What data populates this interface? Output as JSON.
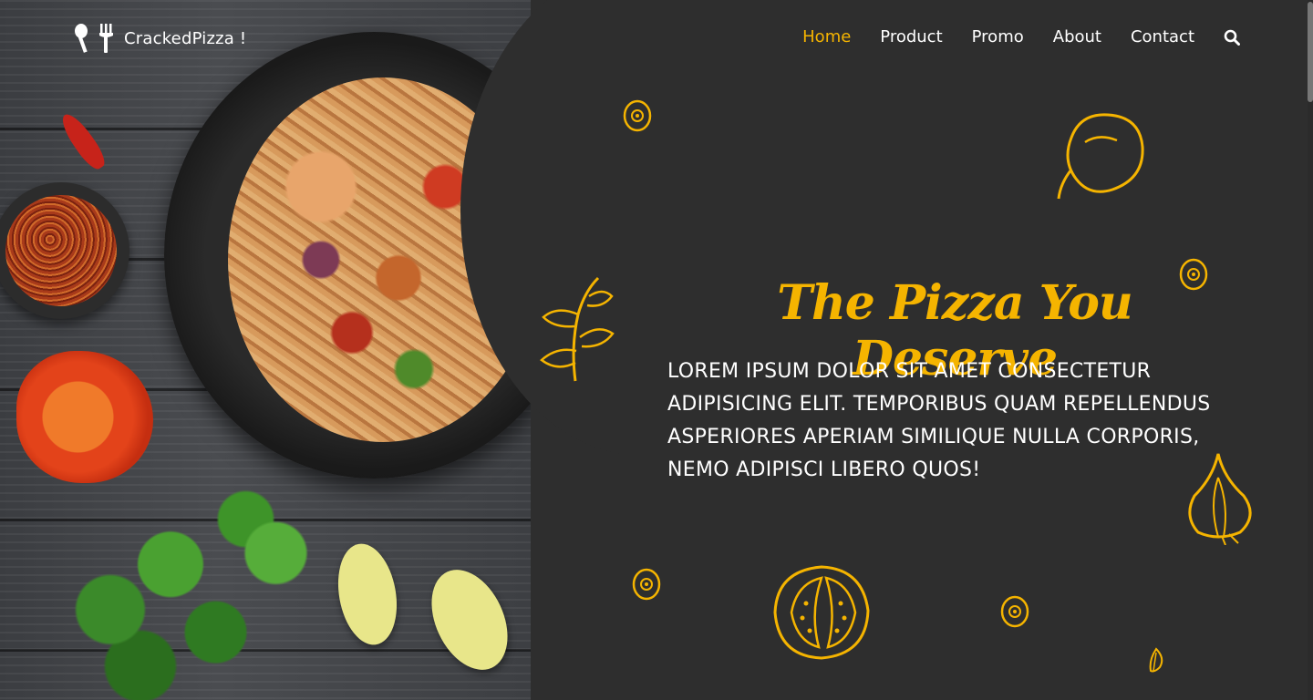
{
  "brand": {
    "name": "CrackedPizza !"
  },
  "nav": {
    "items": [
      {
        "label": "Home",
        "active": true
      },
      {
        "label": "Product",
        "active": false
      },
      {
        "label": "Promo",
        "active": false
      },
      {
        "label": "About",
        "active": false
      },
      {
        "label": "Contact",
        "active": false
      }
    ],
    "search_icon": "search-icon"
  },
  "hero": {
    "title": "The Pizza You Deserve",
    "text": "LOREM IPSUM DOLOR SIT AMET CONSECTETUR ADIPISICING ELIT. TEMPORIBUS QUAM REPELLENDUS ASPERIORES APERIAM SIMILIQUE NULLA CORPORIS, NEMO ADIPISCI LIBERO QUOS!"
  },
  "colors": {
    "accent": "#f5b400",
    "panel": "#2e2e2e",
    "text": "#ffffff"
  }
}
